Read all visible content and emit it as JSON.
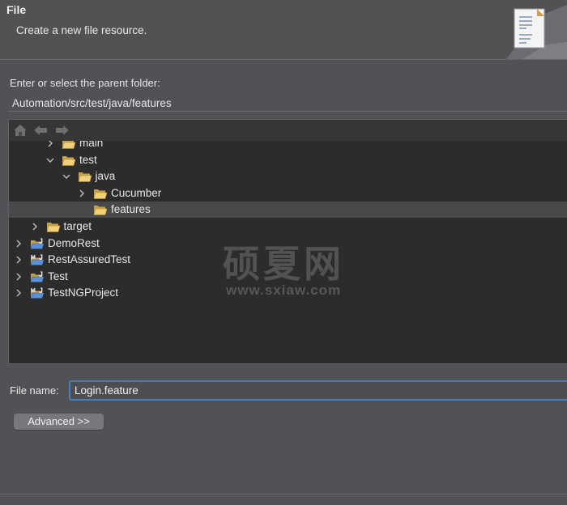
{
  "header": {
    "title": "File",
    "description": "Create a new file resource.",
    "icon": "document-icon"
  },
  "parent_folder": {
    "label": "Enter or select the parent folder:",
    "value": "Automation/src/test/java/features"
  },
  "tree_toolbar": {
    "icons": [
      "home-icon",
      "back-arrow-icon",
      "forward-arrow-icon"
    ]
  },
  "tree": [
    {
      "label": "main",
      "depth": 2,
      "expanded": false,
      "has_children": true,
      "type": "folder"
    },
    {
      "label": "test",
      "depth": 2,
      "expanded": true,
      "has_children": true,
      "type": "folder"
    },
    {
      "label": "java",
      "depth": 3,
      "expanded": true,
      "has_children": true,
      "type": "folder"
    },
    {
      "label": "Cucumber",
      "depth": 4,
      "expanded": false,
      "has_children": true,
      "type": "folder"
    },
    {
      "label": "features",
      "depth": 4,
      "expanded": false,
      "has_children": false,
      "type": "folder",
      "selected": true
    },
    {
      "label": "target",
      "depth": 1,
      "expanded": false,
      "has_children": true,
      "type": "folder"
    },
    {
      "label": "DemoRest",
      "depth": 0,
      "expanded": false,
      "has_children": true,
      "type": "project"
    },
    {
      "label": "RestAssuredTest",
      "depth": 0,
      "expanded": false,
      "has_children": true,
      "type": "maven-project"
    },
    {
      "label": "Test",
      "depth": 0,
      "expanded": false,
      "has_children": true,
      "type": "project"
    },
    {
      "label": "TestNGProject",
      "depth": 0,
      "expanded": false,
      "has_children": true,
      "type": "maven-project"
    }
  ],
  "file_name": {
    "label": "File name:",
    "value": "Login.feature"
  },
  "advanced_button": {
    "label": "Advanced >>"
  },
  "watermark": {
    "line1": "硕夏网",
    "line2": "www.sxiaw.com"
  },
  "colors": {
    "focus_border": "#4a7fb5",
    "tree_bg": "#2c2c2d",
    "selection": "#48494b",
    "folder": "#e9c46a"
  }
}
